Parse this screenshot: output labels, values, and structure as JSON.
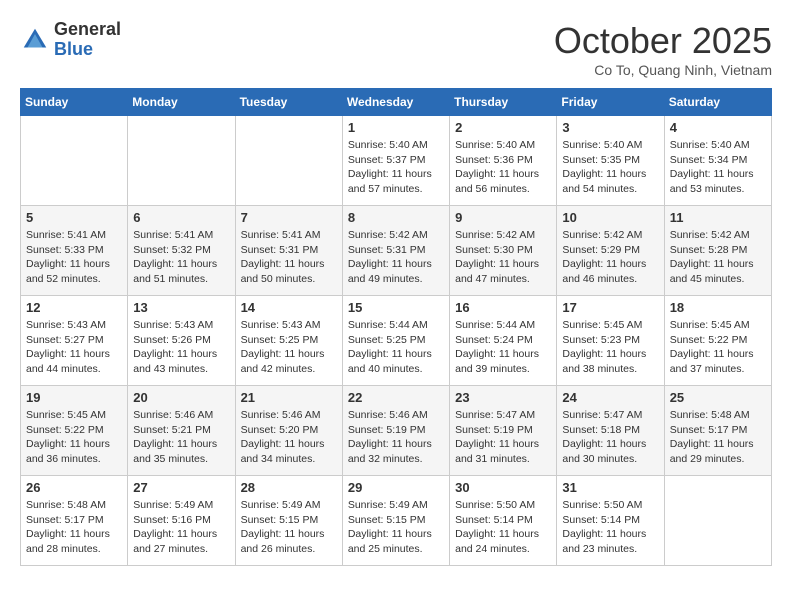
{
  "header": {
    "logo_general": "General",
    "logo_blue": "Blue",
    "month_title": "October 2025",
    "subtitle": "Co To, Quang Ninh, Vietnam"
  },
  "calendar": {
    "weekdays": [
      "Sunday",
      "Monday",
      "Tuesday",
      "Wednesday",
      "Thursday",
      "Friday",
      "Saturday"
    ],
    "weeks": [
      [
        {
          "day": "",
          "info": ""
        },
        {
          "day": "",
          "info": ""
        },
        {
          "day": "",
          "info": ""
        },
        {
          "day": "1",
          "info": "Sunrise: 5:40 AM\nSunset: 5:37 PM\nDaylight: 11 hours\nand 57 minutes."
        },
        {
          "day": "2",
          "info": "Sunrise: 5:40 AM\nSunset: 5:36 PM\nDaylight: 11 hours\nand 56 minutes."
        },
        {
          "day": "3",
          "info": "Sunrise: 5:40 AM\nSunset: 5:35 PM\nDaylight: 11 hours\nand 54 minutes."
        },
        {
          "day": "4",
          "info": "Sunrise: 5:40 AM\nSunset: 5:34 PM\nDaylight: 11 hours\nand 53 minutes."
        }
      ],
      [
        {
          "day": "5",
          "info": "Sunrise: 5:41 AM\nSunset: 5:33 PM\nDaylight: 11 hours\nand 52 minutes."
        },
        {
          "day": "6",
          "info": "Sunrise: 5:41 AM\nSunset: 5:32 PM\nDaylight: 11 hours\nand 51 minutes."
        },
        {
          "day": "7",
          "info": "Sunrise: 5:41 AM\nSunset: 5:31 PM\nDaylight: 11 hours\nand 50 minutes."
        },
        {
          "day": "8",
          "info": "Sunrise: 5:42 AM\nSunset: 5:31 PM\nDaylight: 11 hours\nand 49 minutes."
        },
        {
          "day": "9",
          "info": "Sunrise: 5:42 AM\nSunset: 5:30 PM\nDaylight: 11 hours\nand 47 minutes."
        },
        {
          "day": "10",
          "info": "Sunrise: 5:42 AM\nSunset: 5:29 PM\nDaylight: 11 hours\nand 46 minutes."
        },
        {
          "day": "11",
          "info": "Sunrise: 5:42 AM\nSunset: 5:28 PM\nDaylight: 11 hours\nand 45 minutes."
        }
      ],
      [
        {
          "day": "12",
          "info": "Sunrise: 5:43 AM\nSunset: 5:27 PM\nDaylight: 11 hours\nand 44 minutes."
        },
        {
          "day": "13",
          "info": "Sunrise: 5:43 AM\nSunset: 5:26 PM\nDaylight: 11 hours\nand 43 minutes."
        },
        {
          "day": "14",
          "info": "Sunrise: 5:43 AM\nSunset: 5:25 PM\nDaylight: 11 hours\nand 42 minutes."
        },
        {
          "day": "15",
          "info": "Sunrise: 5:44 AM\nSunset: 5:25 PM\nDaylight: 11 hours\nand 40 minutes."
        },
        {
          "day": "16",
          "info": "Sunrise: 5:44 AM\nSunset: 5:24 PM\nDaylight: 11 hours\nand 39 minutes."
        },
        {
          "day": "17",
          "info": "Sunrise: 5:45 AM\nSunset: 5:23 PM\nDaylight: 11 hours\nand 38 minutes."
        },
        {
          "day": "18",
          "info": "Sunrise: 5:45 AM\nSunset: 5:22 PM\nDaylight: 11 hours\nand 37 minutes."
        }
      ],
      [
        {
          "day": "19",
          "info": "Sunrise: 5:45 AM\nSunset: 5:22 PM\nDaylight: 11 hours\nand 36 minutes."
        },
        {
          "day": "20",
          "info": "Sunrise: 5:46 AM\nSunset: 5:21 PM\nDaylight: 11 hours\nand 35 minutes."
        },
        {
          "day": "21",
          "info": "Sunrise: 5:46 AM\nSunset: 5:20 PM\nDaylight: 11 hours\nand 34 minutes."
        },
        {
          "day": "22",
          "info": "Sunrise: 5:46 AM\nSunset: 5:19 PM\nDaylight: 11 hours\nand 32 minutes."
        },
        {
          "day": "23",
          "info": "Sunrise: 5:47 AM\nSunset: 5:19 PM\nDaylight: 11 hours\nand 31 minutes."
        },
        {
          "day": "24",
          "info": "Sunrise: 5:47 AM\nSunset: 5:18 PM\nDaylight: 11 hours\nand 30 minutes."
        },
        {
          "day": "25",
          "info": "Sunrise: 5:48 AM\nSunset: 5:17 PM\nDaylight: 11 hours\nand 29 minutes."
        }
      ],
      [
        {
          "day": "26",
          "info": "Sunrise: 5:48 AM\nSunset: 5:17 PM\nDaylight: 11 hours\nand 28 minutes."
        },
        {
          "day": "27",
          "info": "Sunrise: 5:49 AM\nSunset: 5:16 PM\nDaylight: 11 hours\nand 27 minutes."
        },
        {
          "day": "28",
          "info": "Sunrise: 5:49 AM\nSunset: 5:15 PM\nDaylight: 11 hours\nand 26 minutes."
        },
        {
          "day": "29",
          "info": "Sunrise: 5:49 AM\nSunset: 5:15 PM\nDaylight: 11 hours\nand 25 minutes."
        },
        {
          "day": "30",
          "info": "Sunrise: 5:50 AM\nSunset: 5:14 PM\nDaylight: 11 hours\nand 24 minutes."
        },
        {
          "day": "31",
          "info": "Sunrise: 5:50 AM\nSunset: 5:14 PM\nDaylight: 11 hours\nand 23 minutes."
        },
        {
          "day": "",
          "info": ""
        }
      ]
    ]
  }
}
